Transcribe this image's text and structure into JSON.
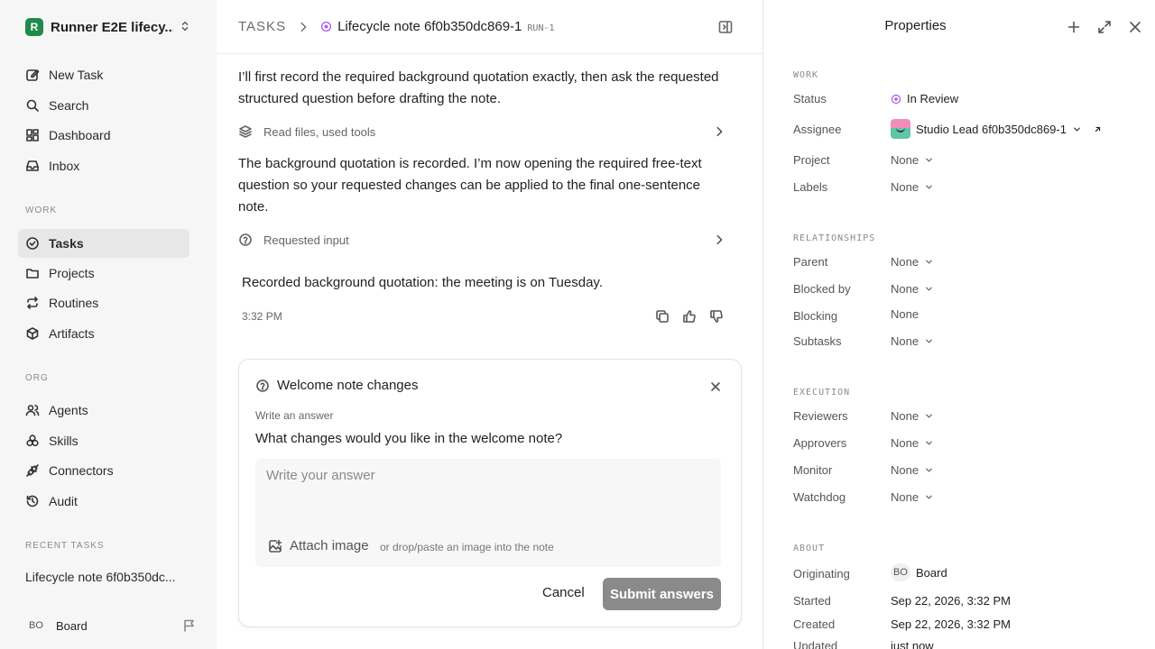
{
  "workspace": {
    "logo": "R",
    "name": "Runner E2E lifecy..."
  },
  "nav": {
    "top": [
      {
        "label": "New Task",
        "icon": "edit-icon"
      },
      {
        "label": "Search",
        "icon": "search-icon"
      },
      {
        "label": "Dashboard",
        "icon": "dashboard-icon"
      },
      {
        "label": "Inbox",
        "icon": "inbox-icon"
      }
    ],
    "work_label": "WORK",
    "work": [
      {
        "label": "Tasks",
        "icon": "check-circle-icon",
        "active": true
      },
      {
        "label": "Projects",
        "icon": "folder-icon"
      },
      {
        "label": "Routines",
        "icon": "repeat-icon"
      },
      {
        "label": "Artifacts",
        "icon": "box-icon"
      }
    ],
    "org_label": "ORG",
    "org": [
      {
        "label": "Agents",
        "icon": "users-icon"
      },
      {
        "label": "Skills",
        "icon": "skills-icon"
      },
      {
        "label": "Connectors",
        "icon": "plug-icon"
      },
      {
        "label": "Audit",
        "icon": "history-icon"
      }
    ],
    "recent_label": "RECENT TASKS",
    "recent": [
      "Lifecycle note 6f0b350dc..."
    ]
  },
  "user": {
    "initials": "BO",
    "name": "Board"
  },
  "header": {
    "root": "TASKS",
    "title": "Lifecycle note 6f0b350dc869-1",
    "run": "RUN-1"
  },
  "messages": {
    "m1": "I’ll first record the required background quotation exactly, then ask the requested structured question before drafting the note.",
    "tool1": "Read files, used tools",
    "m2": "The background quotation is recorded. I’m now opening the required free-text question so your requested changes can be applied to the final one-sentence note.",
    "tool2": "Requested input",
    "m3": "Recorded background quotation: the meeting is on Tuesday.",
    "time": "3:32 PM"
  },
  "question_card": {
    "title": "Welcome note changes",
    "label": "Write an answer",
    "question": "What changes would you like in the welcome note?",
    "placeholder": "Write your answer",
    "attach": "Attach image",
    "drop_hint": "or drop/paste an image into the note",
    "cancel": "Cancel",
    "submit": "Submit answers"
  },
  "properties": {
    "title": "Properties",
    "sections": {
      "work": "WORK",
      "relationships": "RELATIONSHIPS",
      "execution": "EXECUTION",
      "about": "ABOUT"
    },
    "status_label": "Status",
    "status": "In Review",
    "assignee_label": "Assignee",
    "assignee": "Studio Lead 6f0b350dc869-1",
    "project_label": "Project",
    "project": "None",
    "labels_label": "Labels",
    "labels": "None",
    "parent_label": "Parent",
    "parent": "None",
    "blocked_by_label": "Blocked by",
    "blocked_by": "None",
    "blocking_label": "Blocking",
    "blocking": "None",
    "subtasks_label": "Subtasks",
    "subtasks": "None",
    "reviewers_label": "Reviewers",
    "reviewers": "None",
    "approvers_label": "Approvers",
    "approvers": "None",
    "monitor_label": "Monitor",
    "monitor": "None",
    "watchdog_label": "Watchdog",
    "watchdog": "None",
    "originating_label": "Originating",
    "originating_initials": "BO",
    "originating": "Board",
    "started_label": "Started",
    "started": "Sep 22, 2026, 3:32 PM",
    "created_label": "Created",
    "created": "Sep 22, 2026, 3:32 PM",
    "updated_label": "Updated",
    "updated": "just now"
  },
  "colors": {
    "accent": "#a855f7",
    "workspace": "#1f8a4c",
    "submit": "#8a8a8a"
  }
}
